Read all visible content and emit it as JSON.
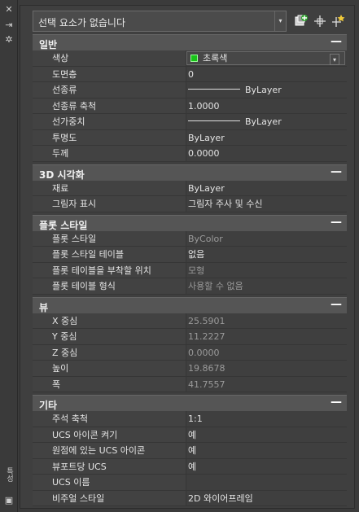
{
  "sidebar": {
    "close": "✕",
    "pin": "⇥",
    "settings": "✲",
    "title": "특성",
    "bottom": "▣"
  },
  "selector": {
    "value": "선택 요소가 없습니다",
    "arrow": "▾"
  },
  "sections": [
    {
      "title": "일반",
      "collapse": "—",
      "rows": [
        {
          "label": "색상",
          "value": "초록색",
          "kind": "color"
        },
        {
          "label": "도면층",
          "value": "0"
        },
        {
          "label": "선종류",
          "value": "ByLayer",
          "kind": "line"
        },
        {
          "label": "선종류 축척",
          "value": "1.0000"
        },
        {
          "label": "선가중치",
          "value": "ByLayer",
          "kind": "line"
        },
        {
          "label": "투명도",
          "value": "ByLayer"
        },
        {
          "label": "두께",
          "value": "0.0000"
        }
      ]
    },
    {
      "title": "3D 시각화",
      "collapse": "—",
      "rows": [
        {
          "label": "재료",
          "value": "ByLayer"
        },
        {
          "label": "그림자 표시",
          "value": "그림자 주사 및 수신"
        }
      ]
    },
    {
      "title": "플롯 스타일",
      "collapse": "—",
      "rows": [
        {
          "label": "플롯 스타일",
          "value": "ByColor",
          "dim": true
        },
        {
          "label": "플롯 스타일 테이블",
          "value": "없음"
        },
        {
          "label": "플롯 테이블을 부착할 위치",
          "value": "모형",
          "dim": true
        },
        {
          "label": "플롯 테이블 형식",
          "value": "사용할 수 없음",
          "dim": true
        }
      ]
    },
    {
      "title": "뷰",
      "collapse": "—",
      "rows": [
        {
          "label": "X 중심",
          "value": "25.5901",
          "dim": true
        },
        {
          "label": "Y 중심",
          "value": "11.2227",
          "dim": true
        },
        {
          "label": "Z 중심",
          "value": "0.0000",
          "dim": true
        },
        {
          "label": "높이",
          "value": "19.8678",
          "dim": true
        },
        {
          "label": "폭",
          "value": "41.7557",
          "dim": true
        }
      ]
    },
    {
      "title": "기타",
      "collapse": "—",
      "rows": [
        {
          "label": "주석 축척",
          "value": "1:1"
        },
        {
          "label": "UCS 아이콘 켜기",
          "value": "예"
        },
        {
          "label": "원점에 있는 UCS 아이콘",
          "value": "예"
        },
        {
          "label": "뷰포트당 UCS",
          "value": "예"
        },
        {
          "label": "UCS 이름",
          "value": ""
        },
        {
          "label": "비주얼 스타일",
          "value": "2D 와이어프레임"
        }
      ]
    }
  ],
  "colors": {
    "green_swatch": "#18c418",
    "section_bg": "#555555"
  }
}
